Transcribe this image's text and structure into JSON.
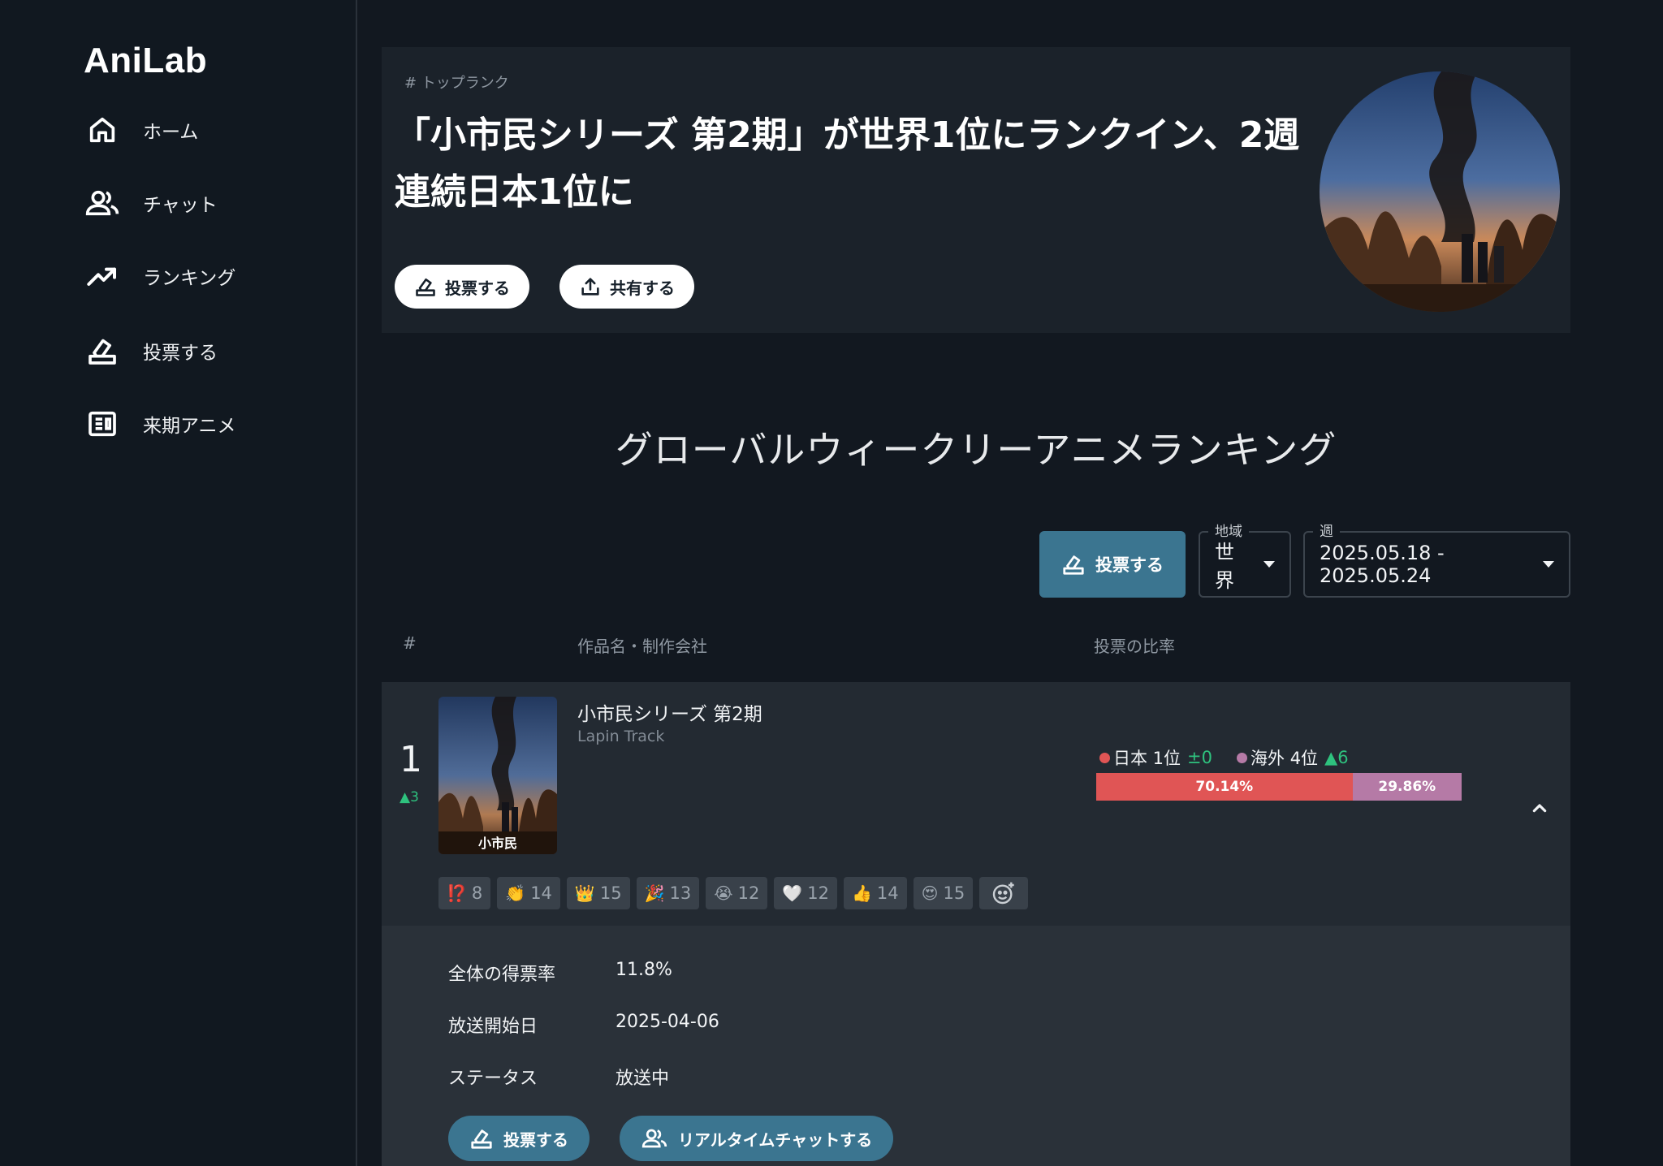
{
  "app": {
    "brand": "AniLab"
  },
  "sidebar": {
    "items": [
      {
        "label": "ホーム",
        "icon": "home-icon"
      },
      {
        "label": "チャット",
        "icon": "users-icon"
      },
      {
        "label": "ランキング",
        "icon": "trending-up-icon"
      },
      {
        "label": "投票する",
        "icon": "ballot-icon"
      },
      {
        "label": "来期アニメ",
        "icon": "news-icon"
      }
    ]
  },
  "hero": {
    "tag": "# トップランク",
    "title": "「小市民シリーズ 第2期」が世界1位にランクイン、2週連続日本1位に",
    "vote_label": "投票する",
    "share_label": "共有する"
  },
  "ranking": {
    "title": "グローバルウィークリーアニメランキング",
    "vote_label": "投票する",
    "region_legend": "地域",
    "region_value": "世界",
    "week_legend": "週",
    "week_value": "2025.05.18 - 2025.05.24",
    "columns": {
      "rank": "#",
      "title": "作品名・制作会社",
      "ratio": "投票の比率"
    }
  },
  "entry": {
    "rank": "1",
    "rank_change": "▲3",
    "poster_text": "小市民",
    "title": "小市民シリーズ 第2期",
    "studio": "Lapin Track",
    "japan_label": "日本 1位",
    "japan_change": "±0",
    "overseas_label": "海外 4位",
    "overseas_change": "▲6",
    "japan_percent": "70.14%",
    "overseas_percent": "29.86%",
    "japan_share": 70.14,
    "overseas_share": 29.86,
    "colors": {
      "japan": "#e05555",
      "overseas": "#b57aa6",
      "up": "#2ec27e"
    },
    "reactions": [
      {
        "emoji": "⁉️",
        "count": "8"
      },
      {
        "emoji": "👏",
        "count": "14"
      },
      {
        "emoji": "👑",
        "count": "15"
      },
      {
        "emoji": "🎉",
        "count": "13"
      },
      {
        "emoji": "😭",
        "count": "12"
      },
      {
        "emoji": "🤍",
        "count": "12"
      },
      {
        "emoji": "👍",
        "count": "14"
      },
      {
        "emoji": "😍",
        "count": "15"
      }
    ],
    "details": {
      "vote_rate_label": "全体の得票率",
      "vote_rate": "11.8%",
      "air_date_label": "放送開始日",
      "air_date": "2025-04-06",
      "status_label": "ステータス",
      "status": "放送中"
    },
    "vote_button": "投票する",
    "chat_button": "リアルタイムチャットする"
  }
}
